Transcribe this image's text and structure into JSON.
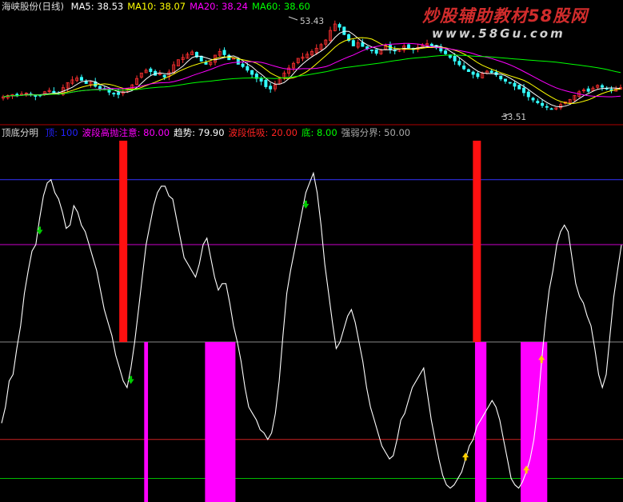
{
  "window": {
    "stock_title": "海峡股份(日线)",
    "ma": [
      {
        "label": "MA5:",
        "value": "38.53",
        "color": "#ffffff"
      },
      {
        "label": "MA10:",
        "value": "38.07",
        "color": "#ffff00"
      },
      {
        "label": "MA20:",
        "value": "38.24",
        "color": "#ff00ff"
      },
      {
        "label": "MA60:",
        "value": "38.60",
        "color": "#00ff00"
      }
    ],
    "high_label": "53.43",
    "low_label": "33.51"
  },
  "watermark": {
    "line1": "炒股辅助教材58股网",
    "line2": "www.58Gu.com"
  },
  "indicator": {
    "name": "顶底分明",
    "legend": [
      {
        "label": "顶:",
        "value": "100",
        "color": "#2222ff"
      },
      {
        "label": "波段高抛注意:",
        "value": "80.00",
        "color": "#ff00ff"
      },
      {
        "label": "趋势:",
        "value": "79.90",
        "color": "#ffffff"
      },
      {
        "label": "波段低吸:",
        "value": "20.00",
        "color": "#ff2222"
      },
      {
        "label": "底:",
        "value": "8.00",
        "color": "#00ff00"
      },
      {
        "label": "强弱分界:",
        "value": "50.00",
        "color": "#aaaaaa"
      }
    ]
  },
  "colors": {
    "up": "#ff3030",
    "down": "#33ffff",
    "ma5": "#ffffff",
    "ma10": "#ffff00",
    "ma20": "#ff00ff",
    "ma60": "#00ff00",
    "red_bar": "#ff1010",
    "magenta_bar": "#ff00ff",
    "sell_arrow": "#00cc00",
    "buy_arrow": "#ffd000"
  },
  "chart_data": [
    {
      "type": "candlestick",
      "series": [
        "MA5",
        "MA10",
        "MA20",
        "MA60"
      ],
      "high": 53.43,
      "low": 33.51,
      "ma_last": {
        "MA5": 38.53,
        "MA10": 38.07,
        "MA20": 38.24,
        "MA60": 38.6
      },
      "closes": [
        36.5,
        36.8,
        37.0,
        36.7,
        37.1,
        37.3,
        37.0,
        36.6,
        36.8,
        37.6,
        37.9,
        37.4,
        37.2,
        38.5,
        39.6,
        40.2,
        40.6,
        40.1,
        39.4,
        39.7,
        38.8,
        38.1,
        38.3,
        37.5,
        37.2,
        37.0,
        37.6,
        38.3,
        39.1,
        40.5,
        41.7,
        42.3,
        42.0,
        41.2,
        41.5,
        40.8,
        41.9,
        43.5,
        44.6,
        45.1,
        45.8,
        46.3,
        45.2,
        44.3,
        43.6,
        44.1,
        45.6,
        46.4,
        45.7,
        44.6,
        44.9,
        43.6,
        43.1,
        42.3,
        41.4,
        40.5,
        39.9,
        38.7,
        38.2,
        39.1,
        40.4,
        41.7,
        42.8,
        43.8,
        44.9,
        45.2,
        45.8,
        46.4,
        47.1,
        47.9,
        48.9,
        51.0,
        52.4,
        51.7,
        50.1,
        48.8,
        47.6,
        48.3,
        47.5,
        47.0,
        46.6,
        46.0,
        46.7,
        47.7,
        46.8,
        46.5,
        46.9,
        47.6,
        47.2,
        46.8,
        47.3,
        47.7,
        48.1,
        47.7,
        47.2,
        46.5,
        45.9,
        45.1,
        44.3,
        43.5,
        42.6,
        42.0,
        41.4,
        40.9,
        41.6,
        42.1,
        41.8,
        41.3,
        40.4,
        39.9,
        39.5,
        38.8,
        38.2,
        37.4,
        36.5,
        35.8,
        35.2,
        34.6,
        34.2,
        33.9,
        34.1,
        34.8,
        35.4,
        35.9,
        36.8,
        37.6,
        38.0,
        37.7,
        38.4,
        39.0,
        38.6,
        38.3,
        37.9,
        38.2,
        38.5
      ]
    },
    {
      "type": "line",
      "series": [
        {
          "name": "趋势",
          "last": 79.9
        }
      ],
      "levels": {
        "顶": 100,
        "波段高抛注意": 80,
        "强弱分界": 50,
        "波段低吸": 20,
        "底": 8
      },
      "ylim": [
        0,
        112
      ],
      "values": [
        25,
        30,
        38,
        40,
        48,
        55,
        65,
        72,
        78,
        80,
        88,
        95,
        99,
        100,
        96,
        94,
        90,
        85,
        86,
        92,
        90,
        86,
        84,
        80,
        76,
        72,
        66,
        60,
        56,
        52,
        46,
        42,
        38,
        36,
        42,
        50,
        60,
        70,
        80,
        86,
        92,
        96,
        98,
        98,
        95,
        94,
        88,
        82,
        76,
        74,
        72,
        70,
        74,
        80,
        82,
        76,
        70,
        66,
        68,
        68,
        62,
        55,
        50,
        44,
        36,
        30,
        28,
        26,
        23,
        22,
        20,
        22,
        28,
        38,
        52,
        65,
        72,
        78,
        84,
        90,
        96,
        99,
        102,
        96,
        86,
        74,
        65,
        56,
        48,
        50,
        54,
        58,
        60,
        56,
        50,
        44,
        36,
        30,
        26,
        22,
        18,
        16,
        14,
        15,
        20,
        26,
        28,
        32,
        36,
        38,
        40,
        42,
        34,
        26,
        20,
        14,
        9,
        6,
        5,
        6,
        8,
        10,
        14,
        18,
        20,
        24,
        26,
        28,
        30,
        32,
        30,
        26,
        20,
        14,
        8,
        6,
        5,
        7,
        10,
        14,
        20,
        30,
        44,
        56,
        66,
        72,
        80,
        84,
        86,
        84,
        76,
        68,
        64,
        62,
        58,
        55,
        48,
        40,
        36,
        40,
        52,
        64,
        72,
        79.9
      ],
      "red_bars_top": [
        32,
        125
      ],
      "red_bars_bottom": [
        138
      ],
      "magenta_pillar_blocks": [
        [
          38,
          38
        ],
        [
          54,
          61
        ],
        [
          125,
          127
        ],
        [
          137,
          143
        ]
      ],
      "sell_signals": [
        10,
        34,
        80
      ],
      "buy_signals": [
        122,
        138,
        142
      ]
    }
  ]
}
